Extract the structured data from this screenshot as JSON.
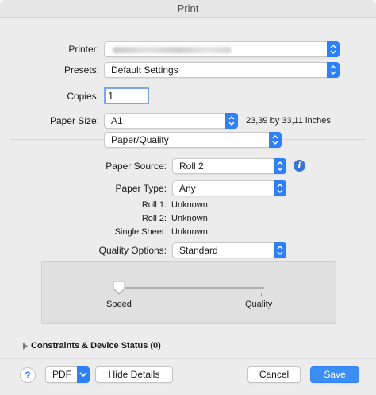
{
  "window": {
    "title": "Print"
  },
  "printer": {
    "label": "Printer:",
    "value": ""
  },
  "presets": {
    "label": "Presets:",
    "value": "Default Settings"
  },
  "copies": {
    "label": "Copies:",
    "value": "1"
  },
  "paper_size": {
    "label": "Paper Size:",
    "value": "A1",
    "dimensions": "23,39 by 33,11 inches"
  },
  "section": {
    "value": "Paper/Quality"
  },
  "paper_source": {
    "label": "Paper Source:",
    "value": "Roll 2"
  },
  "paper_type": {
    "label": "Paper Type:",
    "value": "Any"
  },
  "status": [
    {
      "label": "Roll 1:",
      "value": "Unknown"
    },
    {
      "label": "Roll 2:",
      "value": "Unknown"
    },
    {
      "label": "Single Sheet:",
      "value": "Unknown"
    }
  ],
  "quality_options": {
    "label": "Quality Options:",
    "value": "Standard"
  },
  "slider": {
    "left_label": "Speed",
    "right_label": "Quality",
    "level": 0
  },
  "constraints": {
    "label": "Constraints & Device Status (0)"
  },
  "footer": {
    "help_label": "?",
    "pdf_label": "PDF",
    "hide_details_label": "Hide Details",
    "cancel_label": "Cancel",
    "save_label": "Save"
  },
  "colors": {
    "accent": "#2f7ff5",
    "window_bg": "#ececec"
  },
  "icons": [
    "chevron-updown-icon",
    "info-icon",
    "disclosure-triangle-icon",
    "chevron-down-icon",
    "help-icon"
  ]
}
